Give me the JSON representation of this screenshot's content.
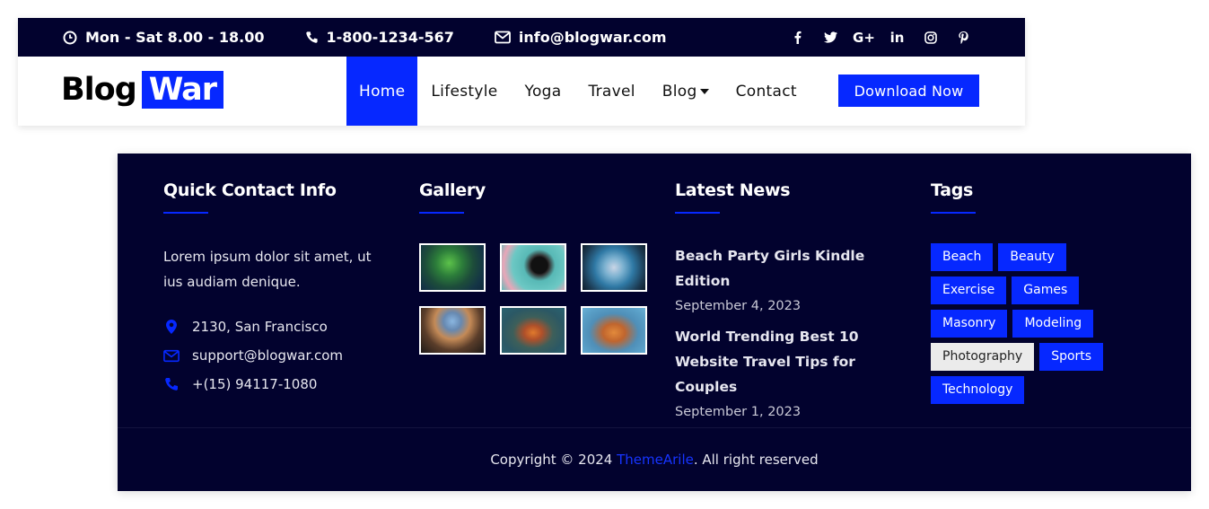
{
  "topbar": {
    "hours": "Mon - Sat 8.00 - 18.00",
    "phone": "1-800-1234-567",
    "email": "info@blogwar.com",
    "social": [
      {
        "icon": "facebook-icon",
        "glyph": "f"
      },
      {
        "icon": "twitter-icon",
        "glyph": "t"
      },
      {
        "icon": "google-plus-icon",
        "glyph": "G+"
      },
      {
        "icon": "linkedin-icon",
        "glyph": "in"
      },
      {
        "icon": "instagram-icon",
        "glyph": "ig"
      },
      {
        "icon": "pinterest-icon",
        "glyph": "p"
      }
    ]
  },
  "logo": {
    "part1": "Blog",
    "part2": "War"
  },
  "nav": {
    "items": [
      "Home",
      "Lifestyle",
      "Yoga",
      "Travel",
      "Blog",
      "Contact"
    ],
    "active": "Home",
    "download_label": "Download Now"
  },
  "footer": {
    "contact": {
      "title": "Quick Contact Info",
      "description": "Lorem ipsum dolor sit amet, ut ius audiam denique.",
      "address": "2130, San Francisco",
      "email": "support@blogwar.com",
      "phone": "+(15) 94117-1080"
    },
    "gallery": {
      "title": "Gallery"
    },
    "news": {
      "title": "Latest News",
      "items": [
        {
          "title": "Beach Party Girls Kindle Edition",
          "date": "September 4, 2023"
        },
        {
          "title": "World Trending Best 10 Website Travel Tips for Couples",
          "date": "September 1, 2023"
        }
      ]
    },
    "tags": {
      "title": "Tags",
      "items": [
        "Beach",
        "Beauty",
        "Exercise",
        "Games",
        "Masonry",
        "Modeling",
        "Photography",
        "Sports",
        "Technology"
      ],
      "highlighted": "Photography"
    },
    "copyright": {
      "prefix": "Copyright © 2024 ",
      "link": "ThemeArile",
      "suffix": ". All right reserved"
    }
  },
  "colors": {
    "dark_navy": "#02022e",
    "accent_blue": "#0628ff"
  }
}
